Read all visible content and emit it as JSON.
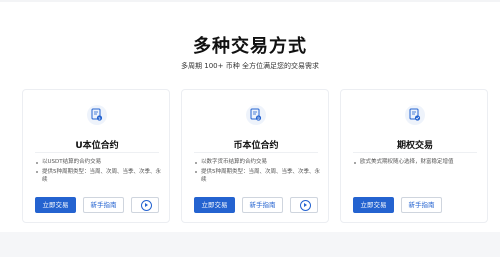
{
  "section": {
    "title": "多种交易方式",
    "subtitle": "多周期 100+ 币种 全方位满足您的交易需求"
  },
  "cards": [
    {
      "icon": "usd-contract-icon",
      "title": "U本位合约",
      "features": [
        "以USDT结算的合约交易",
        "提供5种周期类型：当周、次周、当季、次季、永续"
      ],
      "trade_label": "立即交易",
      "guide_label": "新手指南",
      "video_icon": "play-icon"
    },
    {
      "icon": "coin-contract-icon",
      "title": "币本位合约",
      "features": [
        "以数字货币结算的合约交易",
        "提供5种周期类型：当周、次周、当季、次季、永续"
      ],
      "trade_label": "立即交易",
      "guide_label": "新手指南",
      "video_icon": "play-icon"
    },
    {
      "icon": "options-icon",
      "title": "期权交易",
      "features": [
        "欧式美式期权随心选择，财富稳定增值"
      ],
      "trade_label": "立即交易",
      "guide_label": "新手指南"
    }
  ],
  "colors": {
    "accent": "#2463d0",
    "icon_bg": "#eef3fb"
  }
}
